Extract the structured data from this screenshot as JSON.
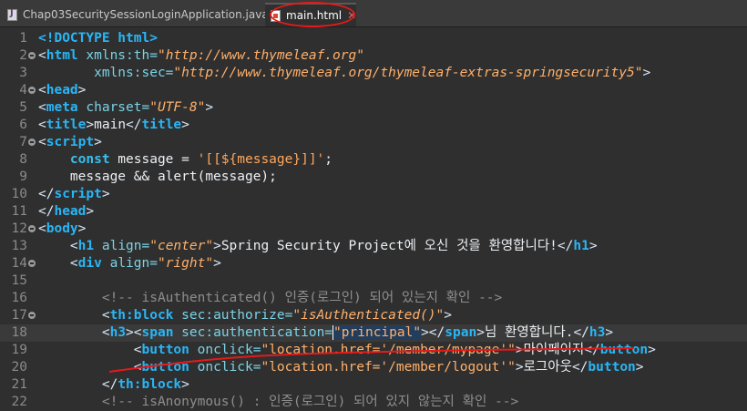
{
  "tabs": [
    {
      "label": "Chap03SecuritySessionLoginApplication.java",
      "icon": "java-file-icon",
      "active": false
    },
    {
      "label": "main.html",
      "icon": "html-file-icon",
      "active": true,
      "close_icon": "close-icon"
    }
  ],
  "annotation_color": "#e51a1a",
  "lines": [
    {
      "n": "1",
      "segs": [
        [
          "t",
          "<!DOCTYPE html>"
        ]
      ]
    },
    {
      "n": "2",
      "fold": true,
      "segs": [
        [
          "tp",
          "<"
        ],
        [
          "t",
          "html"
        ],
        [
          "a",
          " xmlns:th="
        ],
        [
          "s",
          "\"http://www.thymeleaf.org\""
        ]
      ]
    },
    {
      "n": "3",
      "segs": [
        [
          "a",
          "       xmlns:sec="
        ],
        [
          "s",
          "\"http://www.thymeleaf.org/thymeleaf-extras-springsecurity5\""
        ],
        [
          "tp",
          ">"
        ]
      ]
    },
    {
      "n": "4",
      "fold": true,
      "segs": [
        [
          "tp",
          "<"
        ],
        [
          "t",
          "head"
        ],
        [
          "tp",
          ">"
        ]
      ]
    },
    {
      "n": "5",
      "segs": [
        [
          "tp",
          "<"
        ],
        [
          "t",
          "meta"
        ],
        [
          "a",
          " charset="
        ],
        [
          "s",
          "\"UTF-8\""
        ],
        [
          "tp",
          ">"
        ]
      ]
    },
    {
      "n": "6",
      "segs": [
        [
          "tp",
          "<"
        ],
        [
          "t",
          "title"
        ],
        [
          "tp",
          ">"
        ],
        [
          "n",
          "main"
        ],
        [
          "tp",
          "</"
        ],
        [
          "t",
          "title"
        ],
        [
          "tp",
          ">"
        ]
      ]
    },
    {
      "n": "7",
      "fold": true,
      "segs": [
        [
          "tp",
          "<"
        ],
        [
          "t",
          "script"
        ],
        [
          "tp",
          ">"
        ]
      ]
    },
    {
      "n": "8",
      "segs": [
        [
          "n",
          "    "
        ],
        [
          "k",
          "const"
        ],
        [
          "n",
          " message = "
        ],
        [
          "str",
          "'[[${message}]]'"
        ],
        [
          "n",
          ";"
        ]
      ]
    },
    {
      "n": "9",
      "segs": [
        [
          "n",
          "    message && alert(message);"
        ]
      ]
    },
    {
      "n": "10",
      "segs": [
        [
          "tp",
          "</"
        ],
        [
          "t",
          "script"
        ],
        [
          "tp",
          ">"
        ]
      ]
    },
    {
      "n": "11",
      "segs": [
        [
          "tp",
          "</"
        ],
        [
          "t",
          "head"
        ],
        [
          "tp",
          ">"
        ]
      ]
    },
    {
      "n": "12",
      "fold": true,
      "segs": [
        [
          "tp",
          "<"
        ],
        [
          "t",
          "body"
        ],
        [
          "tp",
          ">"
        ]
      ]
    },
    {
      "n": "13",
      "segs": [
        [
          "n",
          "    "
        ],
        [
          "tp",
          "<"
        ],
        [
          "t",
          "h1"
        ],
        [
          "a",
          " align="
        ],
        [
          "s",
          "\"center\""
        ],
        [
          "tp",
          ">"
        ],
        [
          "n",
          "Spring Security Project에 오신 것을 환영합니다!"
        ],
        [
          "tp",
          "</"
        ],
        [
          "t",
          "h1"
        ],
        [
          "tp",
          ">"
        ]
      ]
    },
    {
      "n": "14",
      "fold": true,
      "segs": [
        [
          "n",
          "    "
        ],
        [
          "tp",
          "<"
        ],
        [
          "t",
          "div"
        ],
        [
          "a",
          " align="
        ],
        [
          "s",
          "\"right\""
        ],
        [
          "tp",
          ">"
        ]
      ]
    },
    {
      "n": "15",
      "segs": []
    },
    {
      "n": "16",
      "segs": [
        [
          "c",
          "        <!-- isAuthenticated() 인증(로그인) 되어 있는지 확인 -->"
        ]
      ]
    },
    {
      "n": "17",
      "fold": true,
      "segs": [
        [
          "n",
          "        "
        ],
        [
          "tp",
          "<"
        ],
        [
          "t",
          "th:block"
        ],
        [
          "a",
          " sec:authorize="
        ],
        [
          "s",
          "\"isAuthenticated()\""
        ],
        [
          "tp",
          ">"
        ]
      ]
    },
    {
      "n": "18",
      "current": true,
      "segs": [
        [
          "n",
          "        "
        ],
        [
          "tp",
          "<"
        ],
        [
          "t",
          "h3"
        ],
        [
          "tp",
          "><"
        ],
        [
          "t",
          "span"
        ],
        [
          "a",
          " sec:authentication="
        ],
        [
          "caretsel",
          "\"principal\""
        ],
        [
          "tp",
          "></"
        ],
        [
          "t",
          "span"
        ],
        [
          "tp",
          ">"
        ],
        [
          "n",
          "님 환영합니다."
        ],
        [
          "tp",
          "</"
        ],
        [
          "t",
          "h3"
        ],
        [
          "tp",
          ">"
        ]
      ]
    },
    {
      "n": "19",
      "segs": [
        [
          "n",
          "            "
        ],
        [
          "tp",
          "<"
        ],
        [
          "t",
          "button"
        ],
        [
          "a",
          " onclick="
        ],
        [
          "sp",
          "\"location.href='/member/mypage'\""
        ],
        [
          "tp",
          ">"
        ],
        [
          "n",
          "마이페이지"
        ],
        [
          "tp",
          "</"
        ],
        [
          "t",
          "button"
        ],
        [
          "tp",
          ">"
        ]
      ]
    },
    {
      "n": "20",
      "segs": [
        [
          "n",
          "            "
        ],
        [
          "tp",
          "<"
        ],
        [
          "t",
          "button"
        ],
        [
          "a",
          " onclick="
        ],
        [
          "sp",
          "\"location.href='/member/logout'\""
        ],
        [
          "tp",
          ">"
        ],
        [
          "n",
          "로그아웃"
        ],
        [
          "tp",
          "</"
        ],
        [
          "t",
          "button"
        ],
        [
          "tp",
          ">"
        ]
      ]
    },
    {
      "n": "21",
      "segs": [
        [
          "n",
          "        "
        ],
        [
          "tp",
          "</"
        ],
        [
          "t",
          "th:block"
        ],
        [
          "tp",
          ">"
        ]
      ]
    },
    {
      "n": "22",
      "segs": [
        [
          "c",
          "        <!-- isAnonymous() : 인증(로그인) 되어 있지 않는지 확인 -->"
        ]
      ]
    }
  ]
}
